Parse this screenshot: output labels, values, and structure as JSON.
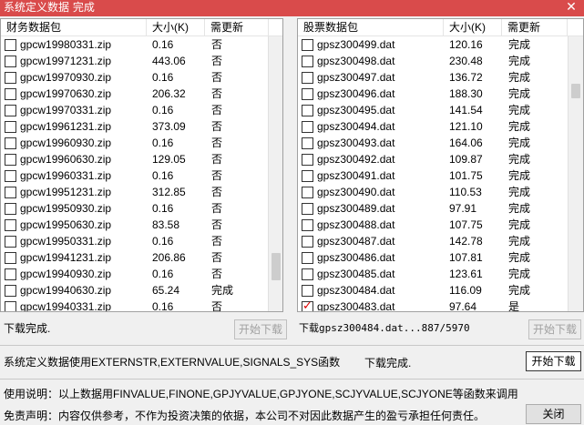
{
  "title": "系统定义数据 完成",
  "close_label": "✕",
  "left_panel": {
    "headers": [
      "财务数据包",
      "大小(K)",
      "需更新"
    ],
    "rows": [
      {
        "name": "gpcw19980331.zip",
        "size": "0.16",
        "update": "否",
        "checked": false
      },
      {
        "name": "gpcw19971231.zip",
        "size": "443.06",
        "update": "否",
        "checked": false
      },
      {
        "name": "gpcw19970930.zip",
        "size": "0.16",
        "update": "否",
        "checked": false
      },
      {
        "name": "gpcw19970630.zip",
        "size": "206.32",
        "update": "否",
        "checked": false
      },
      {
        "name": "gpcw19970331.zip",
        "size": "0.16",
        "update": "否",
        "checked": false
      },
      {
        "name": "gpcw19961231.zip",
        "size": "373.09",
        "update": "否",
        "checked": false
      },
      {
        "name": "gpcw19960930.zip",
        "size": "0.16",
        "update": "否",
        "checked": false
      },
      {
        "name": "gpcw19960630.zip",
        "size": "129.05",
        "update": "否",
        "checked": false
      },
      {
        "name": "gpcw19960331.zip",
        "size": "0.16",
        "update": "否",
        "checked": false
      },
      {
        "name": "gpcw19951231.zip",
        "size": "312.85",
        "update": "否",
        "checked": false
      },
      {
        "name": "gpcw19950930.zip",
        "size": "0.16",
        "update": "否",
        "checked": false
      },
      {
        "name": "gpcw19950630.zip",
        "size": "83.58",
        "update": "否",
        "checked": false
      },
      {
        "name": "gpcw19950331.zip",
        "size": "0.16",
        "update": "否",
        "checked": false
      },
      {
        "name": "gpcw19941231.zip",
        "size": "206.86",
        "update": "否",
        "checked": false
      },
      {
        "name": "gpcw19940930.zip",
        "size": "0.16",
        "update": "否",
        "checked": false
      },
      {
        "name": "gpcw19940630.zip",
        "size": "65.24",
        "update": "完成",
        "checked": false
      },
      {
        "name": "gpcw19940331.zip",
        "size": "0.16",
        "update": "否",
        "checked": false
      }
    ]
  },
  "right_panel": {
    "headers": [
      "股票数据包",
      "大小(K)",
      "需更新"
    ],
    "rows": [
      {
        "name": "gpsz300499.dat",
        "size": "120.16",
        "update": "完成",
        "checked": false
      },
      {
        "name": "gpsz300498.dat",
        "size": "230.48",
        "update": "完成",
        "checked": false
      },
      {
        "name": "gpsz300497.dat",
        "size": "136.72",
        "update": "完成",
        "checked": false
      },
      {
        "name": "gpsz300496.dat",
        "size": "188.30",
        "update": "完成",
        "checked": false
      },
      {
        "name": "gpsz300495.dat",
        "size": "141.54",
        "update": "完成",
        "checked": false
      },
      {
        "name": "gpsz300494.dat",
        "size": "121.10",
        "update": "完成",
        "checked": false
      },
      {
        "name": "gpsz300493.dat",
        "size": "164.06",
        "update": "完成",
        "checked": false
      },
      {
        "name": "gpsz300492.dat",
        "size": "109.87",
        "update": "完成",
        "checked": false
      },
      {
        "name": "gpsz300491.dat",
        "size": "101.75",
        "update": "完成",
        "checked": false
      },
      {
        "name": "gpsz300490.dat",
        "size": "110.53",
        "update": "完成",
        "checked": false
      },
      {
        "name": "gpsz300489.dat",
        "size": "97.91",
        "update": "完成",
        "checked": false
      },
      {
        "name": "gpsz300488.dat",
        "size": "107.75",
        "update": "完成",
        "checked": false
      },
      {
        "name": "gpsz300487.dat",
        "size": "142.78",
        "update": "完成",
        "checked": false
      },
      {
        "name": "gpsz300486.dat",
        "size": "107.81",
        "update": "完成",
        "checked": false
      },
      {
        "name": "gpsz300485.dat",
        "size": "123.61",
        "update": "完成",
        "checked": false
      },
      {
        "name": "gpsz300484.dat",
        "size": "116.09",
        "update": "完成",
        "checked": false
      },
      {
        "name": "gpsz300483.dat",
        "size": "97.64",
        "update": "是",
        "checked": true
      }
    ]
  },
  "left_status": "下载完成.",
  "left_button": "开始下载",
  "right_status": "下载gpsz300484.dat...887/5970",
  "right_button": "开始下载",
  "sys_label": "系统定义数据使用EXTERNSTR,EXTERNVALUE,SIGNALS_SYS函数",
  "sys_status": "下载完成.",
  "sys_button": "开始下载",
  "usage": "使用说明：以上数据用FINVALUE,FINONE,GPJYVALUE,GPJYONE,SCJYVALUE,SCJYONE等函数来调用",
  "disclaimer": "免责声明：内容仅供参考，不作为投资决策的依据，本公司不对因此数据产生的盈亏承担任何责任。",
  "close_button": "关闭"
}
